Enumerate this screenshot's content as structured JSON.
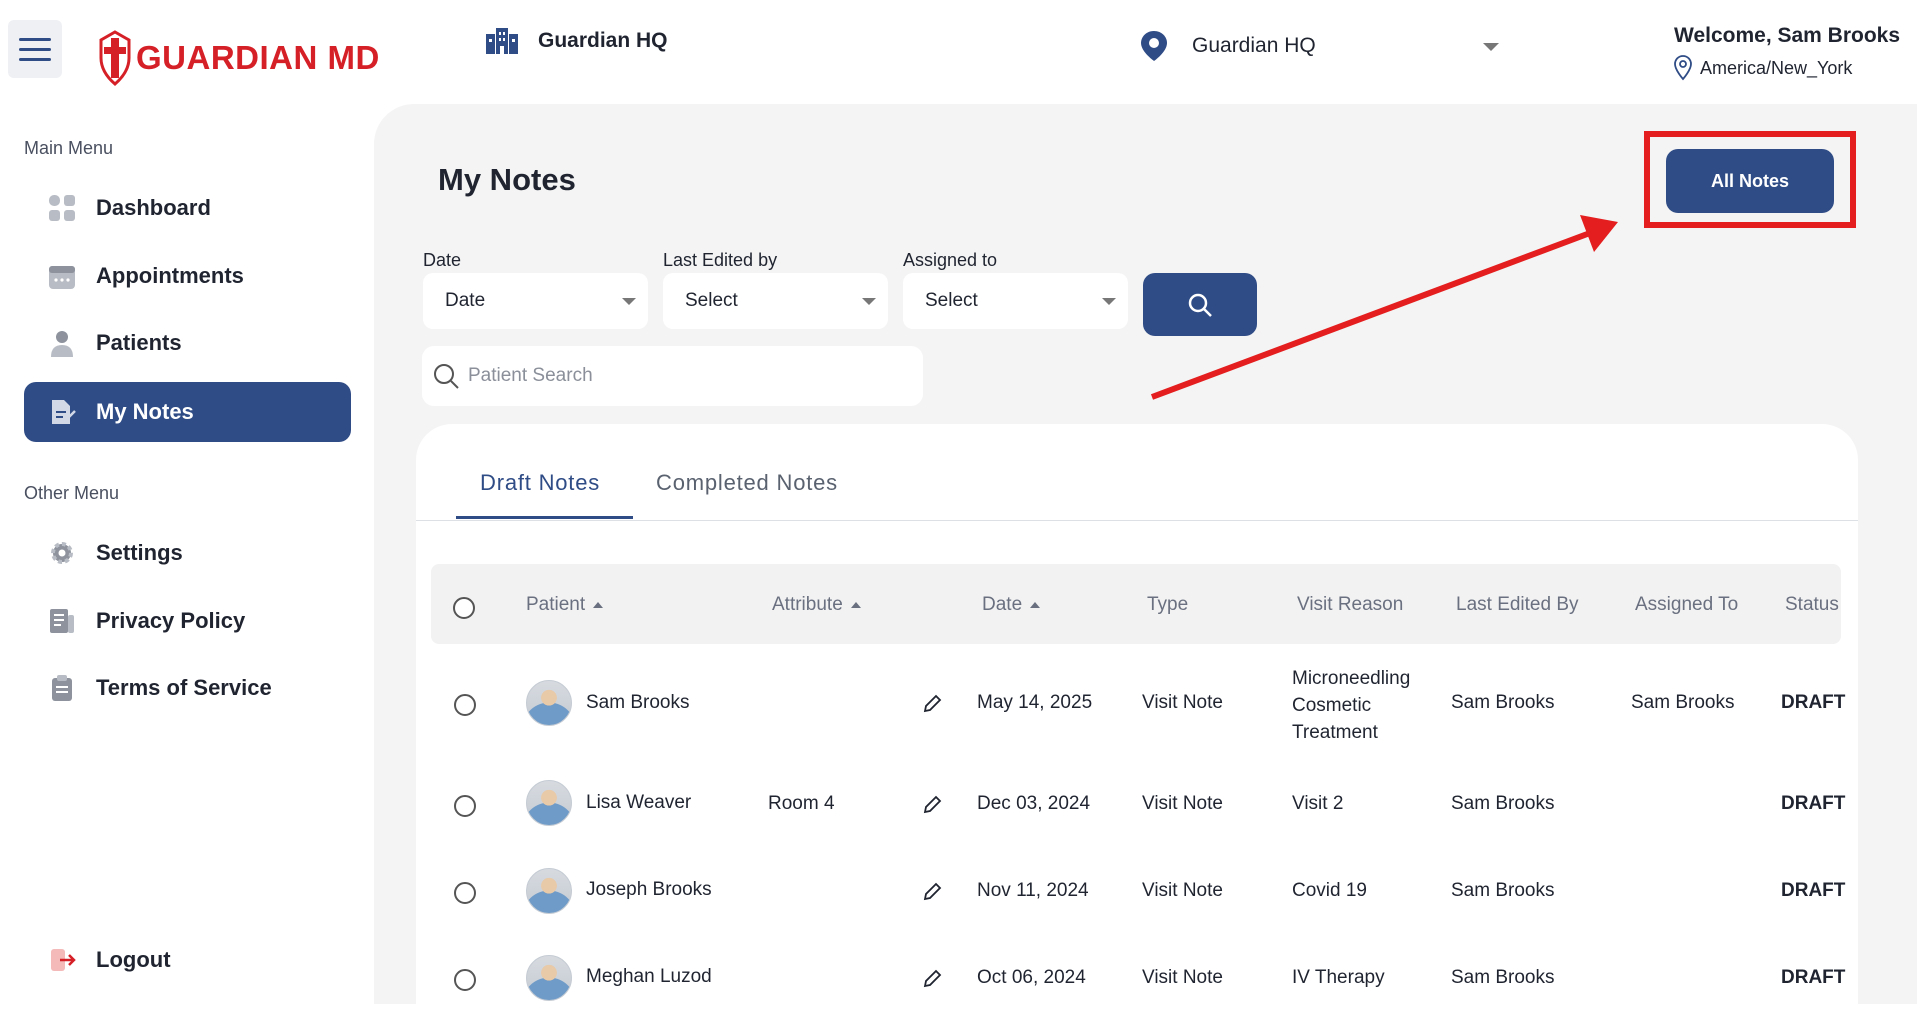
{
  "header": {
    "logo_text": "GUARDIAN MD",
    "organization": "Guardian HQ",
    "location_select": "Guardian HQ",
    "welcome": "Welcome, Sam Brooks",
    "timezone": "America/New_York"
  },
  "sidebar": {
    "main_menu_label": "Main Menu",
    "main_items": [
      {
        "label": "Dashboard",
        "icon": "dashboard-icon"
      },
      {
        "label": "Appointments",
        "icon": "calendar-icon"
      },
      {
        "label": "Patients",
        "icon": "person-icon"
      },
      {
        "label": "My Notes",
        "icon": "notes-icon",
        "active": true
      }
    ],
    "other_menu_label": "Other Menu",
    "other_items": [
      {
        "label": "Settings",
        "icon": "gear-icon"
      },
      {
        "label": "Privacy Policy",
        "icon": "document-icon"
      },
      {
        "label": "Terms of Service",
        "icon": "clipboard-icon"
      }
    ],
    "logout": "Logout"
  },
  "main": {
    "title": "My Notes",
    "all_notes_button": "All Notes",
    "filters": {
      "date_label": "Date",
      "date_value": "Date",
      "last_edited_label": "Last Edited by",
      "last_edited_value": "Select",
      "assigned_label": "Assigned to",
      "assigned_value": "Select"
    },
    "patient_search_placeholder": "Patient Search",
    "tabs": [
      {
        "label": "Draft Notes",
        "active": true
      },
      {
        "label": "Completed Notes",
        "active": false
      }
    ],
    "table": {
      "headers": [
        "Patient",
        "Attribute",
        "Date",
        "Type",
        "Visit Reason",
        "Last Edited By",
        "Assigned To",
        "Status"
      ],
      "rows": [
        {
          "patient": "Sam Brooks",
          "attribute": "",
          "date": "May 14, 2025",
          "type": "Visit Note",
          "visit_reason": [
            "Microneedling",
            "Cosmetic",
            "Treatment"
          ],
          "last_edited_by": "Sam Brooks",
          "assigned_to": "Sam Brooks",
          "status": "DRAFT"
        },
        {
          "patient": "Lisa Weaver",
          "attribute": "Room 4",
          "date": "Dec 03, 2024",
          "type": "Visit Note",
          "visit_reason": [
            "Visit 2"
          ],
          "last_edited_by": "Sam Brooks",
          "assigned_to": "",
          "status": "DRAFT"
        },
        {
          "patient": "Joseph Brooks",
          "attribute": "",
          "date": "Nov 11, 2024",
          "type": "Visit Note",
          "visit_reason": [
            "Covid 19"
          ],
          "last_edited_by": "Sam Brooks",
          "assigned_to": "",
          "status": "DRAFT"
        },
        {
          "patient": "Meghan Luzod",
          "attribute": "",
          "date": "Oct 06, 2024",
          "type": "Visit Note",
          "visit_reason": [
            "IV Therapy"
          ],
          "last_edited_by": "Sam Brooks",
          "assigned_to": "",
          "status": "DRAFT"
        }
      ]
    }
  },
  "colors": {
    "brand_red": "#d62027",
    "primary_blue": "#2f4c86",
    "annotation_red": "#e41e1e"
  }
}
